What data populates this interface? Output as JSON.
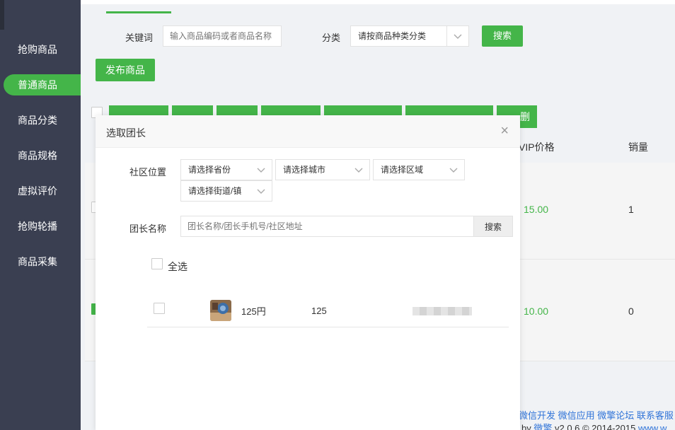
{
  "sidebar": {
    "items": [
      {
        "label": "抢购商品",
        "active": false
      },
      {
        "label": "普通商品",
        "active": true
      },
      {
        "label": "商品分类",
        "active": false
      },
      {
        "label": "商品规格",
        "active": false
      },
      {
        "label": "虚拟评价",
        "active": false
      },
      {
        "label": "抢购轮播",
        "active": false
      },
      {
        "label": "商品采集",
        "active": false
      }
    ]
  },
  "filters": {
    "keyword_label": "关键词",
    "keyword_placeholder": "输入商品编码或者商品名称",
    "category_label": "分类",
    "category_value": "请按商品种类分类",
    "search_button": "搜索"
  },
  "publish_button": "发布商品",
  "bulk_actions": {
    "delete_label": "删除"
  },
  "table": {
    "headers": {
      "vip_price": "VIP价格",
      "sales": "销量"
    },
    "rows": [
      {
        "vip_price": "15.00",
        "sales": "1"
      },
      {
        "vip_price": "10.00",
        "sales": "0"
      }
    ]
  },
  "footer": {
    "links": "微信开发 微信应用 微擎论坛 联系客服",
    "copy_prefix": "by ",
    "copy_brand": "微擎",
    "copy_suffix": " v2.0.6 © 2014-2015 ",
    "copy_url": "www.w"
  },
  "modal": {
    "title": "选取团长",
    "close_glyph": "×",
    "location_label": "社区位置",
    "province_placeholder": "请选择省份",
    "city_placeholder": "请选择城市",
    "district_placeholder": "请选择区域",
    "street_placeholder": "请选择街道/镇",
    "name_label": "团长名称",
    "name_placeholder": "团长名称/团长手机号/社区地址",
    "search_button": "搜索",
    "select_all_label": "全选",
    "results": [
      {
        "name": "125円",
        "phone": "125"
      }
    ]
  },
  "colors": {
    "accent": "#44b549",
    "sidebar_bg": "#3a3f51",
    "link": "#2f73d8"
  }
}
